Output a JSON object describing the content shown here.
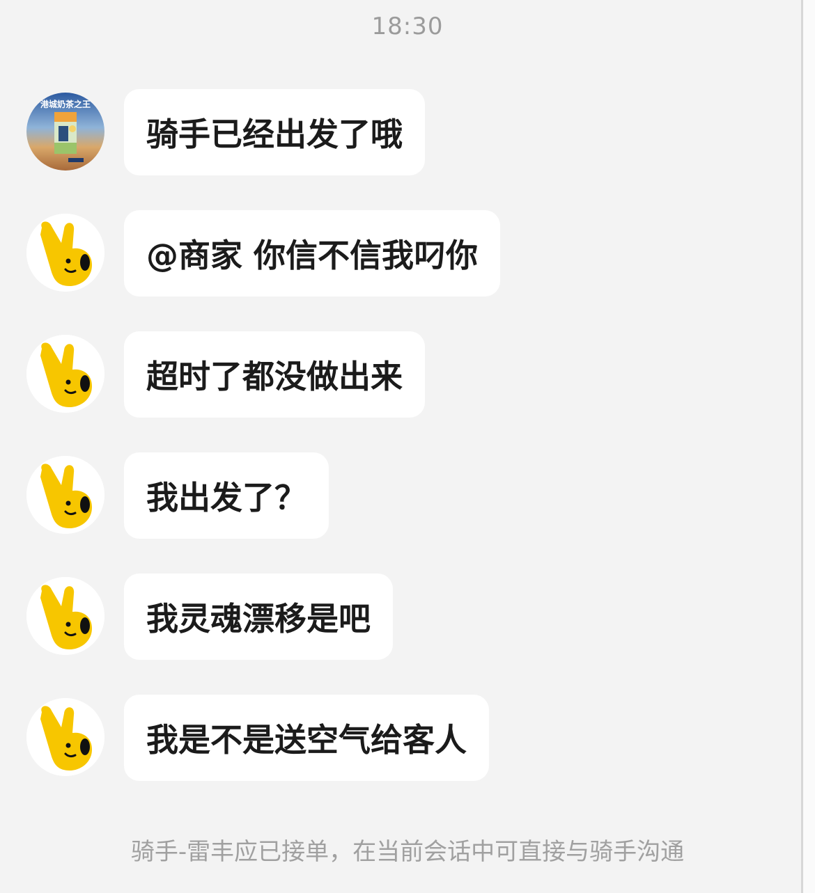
{
  "chat": {
    "timestamp": "18:30",
    "messages": [
      {
        "sender": "merchant",
        "avatar": "milk-tea-shop-avatar",
        "text": "骑手已经出发了哦"
      },
      {
        "sender": "customer",
        "avatar": "yellow-hand-mascot-avatar",
        "text": "@商家 你信不信我叼你"
      },
      {
        "sender": "customer",
        "avatar": "yellow-hand-mascot-avatar",
        "text": "超时了都没做出来"
      },
      {
        "sender": "customer",
        "avatar": "yellow-hand-mascot-avatar",
        "text": "我出发了？"
      },
      {
        "sender": "customer",
        "avatar": "yellow-hand-mascot-avatar",
        "text": "我灵魂漂移是吧"
      },
      {
        "sender": "customer",
        "avatar": "yellow-hand-mascot-avatar",
        "text": "我是不是送空气给客人"
      }
    ],
    "system_notice": "骑手-雷丰应已接单，在当前会话中可直接与骑手沟通",
    "merchant_avatar_text": "港城奶茶之王"
  },
  "colors": {
    "background": "#f3f3f3",
    "bubble": "#ffffff",
    "text": "#1b1b1b",
    "muted_text": "#9b9b9b",
    "mascot_yellow": "#f7c600"
  }
}
